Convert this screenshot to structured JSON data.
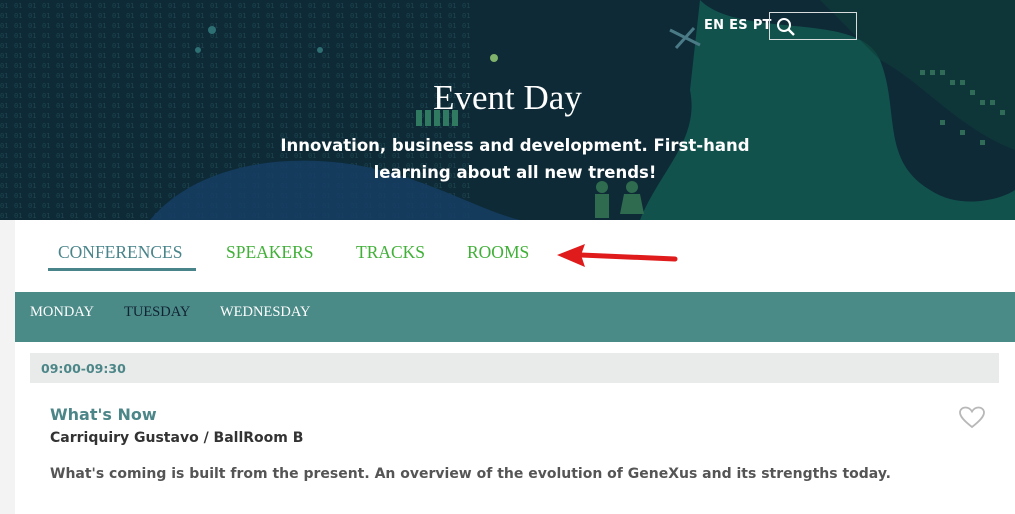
{
  "header": {
    "languages": [
      "EN",
      "ES",
      "PT"
    ],
    "search": {
      "value": "",
      "placeholder": ""
    },
    "title": "Event Day",
    "subtitle": "Innovation, business and development. First-hand learning about all new trends!"
  },
  "nav": {
    "tabs": [
      {
        "label": "CONFERENCES",
        "active": true
      },
      {
        "label": "SPEAKERS",
        "active": false
      },
      {
        "label": "TRACKS",
        "active": false
      },
      {
        "label": "ROOMS",
        "active": false
      }
    ]
  },
  "days": [
    {
      "label": "MONDAY",
      "active": false
    },
    {
      "label": "TUESDAY",
      "active": true
    },
    {
      "label": "WEDNESDAY",
      "active": false
    }
  ],
  "schedule": {
    "time_slot": "09:00-09:30",
    "session": {
      "title": "What's Now",
      "meta": "Carriquiry Gustavo / BallRoom B",
      "description": "What's coming is built from the present. An overview of the evolution of GeneXus and its strengths today."
    }
  },
  "colors": {
    "hero_bg": "#0d2a36",
    "accent_teal": "#4a8a87",
    "tab_green": "#41b038",
    "annotation_arrow": "#e01b1b"
  },
  "icons": {
    "search": "search-icon",
    "favorite": "heart-outline-icon",
    "annotation": "red-arrow-icon"
  }
}
